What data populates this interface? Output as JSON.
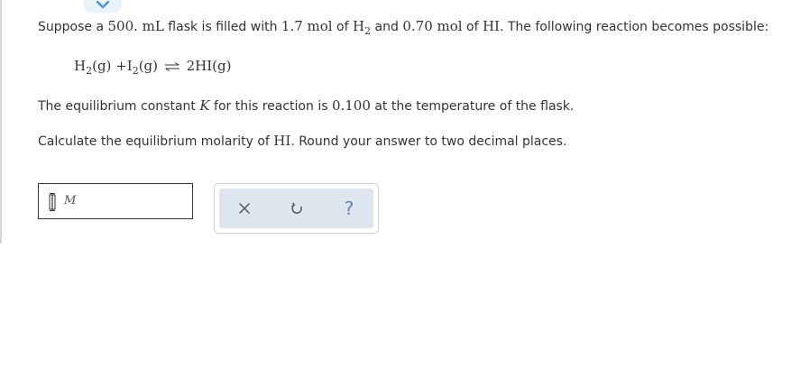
{
  "question": {
    "intro_pre": "Suppose a ",
    "volume": "500. mL",
    "intro_mid1": " flask is filled with ",
    "h2_amount": "1.7 mol",
    "of1": " of ",
    "h2_species": "H",
    "h2_sub": "2",
    "intro_mid2": " and ",
    "hi_amount": "0.70 mol",
    "of2": " of ",
    "hi_species": "HI",
    "intro_post": ". The following reaction becomes possible:",
    "eq_h2": "H",
    "eq_h2_sub": "2",
    "eq_h2_state": "(g)",
    "eq_plus": "+",
    "eq_i2": "I",
    "eq_i2_sub": "2",
    "eq_i2_state": "(g)",
    "eq_product": "2HI",
    "eq_product_state": "(g)",
    "k_pre": "The equilibrium constant ",
    "k_symbol": "K",
    "k_mid": " for this reaction is ",
    "k_value": "0.100",
    "k_post": " at the temperature of the flask.",
    "ask_pre": "Calculate the equilibrium molarity of ",
    "ask_species": "HI",
    "ask_post": ". Round your answer to two decimal places."
  },
  "answer": {
    "value": "",
    "unit": "M"
  },
  "toolbar": {
    "clear_icon": "x-icon",
    "undo_icon": "undo-icon",
    "help_label": "?"
  },
  "colors": {
    "tab_bg": "#e9f3fb",
    "tab_chevron": "#4a90d9",
    "toolbar_bg": "#dde6ee",
    "help_color": "#5a8ab0"
  }
}
